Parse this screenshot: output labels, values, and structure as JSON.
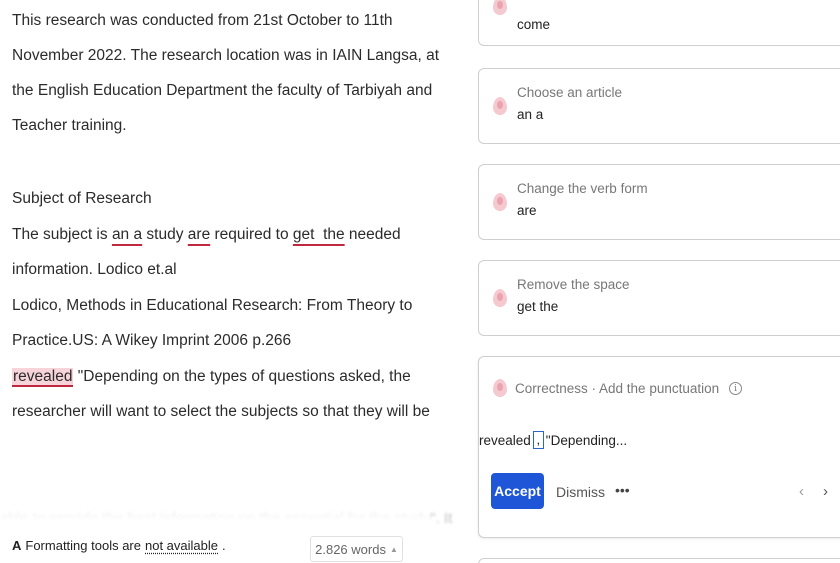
{
  "editor": {
    "para1": [
      "This research was conducted from 21st October to 11th",
      "November 2022. The research location was in IAIN Langsa, at",
      "the English Education Department the faculty of Tarbiyah and",
      "Teacher training."
    ],
    "heading": "Subject of Research",
    "subject_line": {
      "t1": "The subject is ",
      "err1": "an a",
      "t2": " study ",
      "err2": "are",
      "t3": " required to ",
      "err3": "get  the",
      "t4": " needed"
    },
    "info_line": "information. Lodico et.al",
    "ref_line1": "Lodico, Methods in Educational Research: From Theory to",
    "ref_line2": "Practice.US: A Wikey Imprint 2006 p.266",
    "quote_line1": {
      "err": "revealed",
      "rest": " \"Depending on the types of questions asked, the"
    },
    "quote_line2": "researcher will want to select the subjects so that they will be"
  },
  "footer": {
    "prefix": "Formatting tools are",
    "link": "not available",
    "suffix": ".",
    "word_count": "2.826 words"
  },
  "suggestions": {
    "cards": [
      {
        "title": "",
        "value": "come"
      },
      {
        "title": "Choose an article",
        "value": "an a"
      },
      {
        "title": "Change the verb form",
        "value": "are"
      },
      {
        "title": "Remove the space",
        "value": "get the"
      }
    ],
    "expanded": {
      "header": "Correctness · Add the punctuation",
      "before": "revealed",
      "inserted": ",",
      "after": " \"Depending...",
      "accept_label": "Accept",
      "dismiss_label": "Dismiss",
      "more_label": "•••",
      "prev_label": "‹",
      "next_label": "›"
    }
  },
  "colors": {
    "error_underline": "#c0283e",
    "highlight": "#f7d4da",
    "accent": "#1f56d8"
  }
}
